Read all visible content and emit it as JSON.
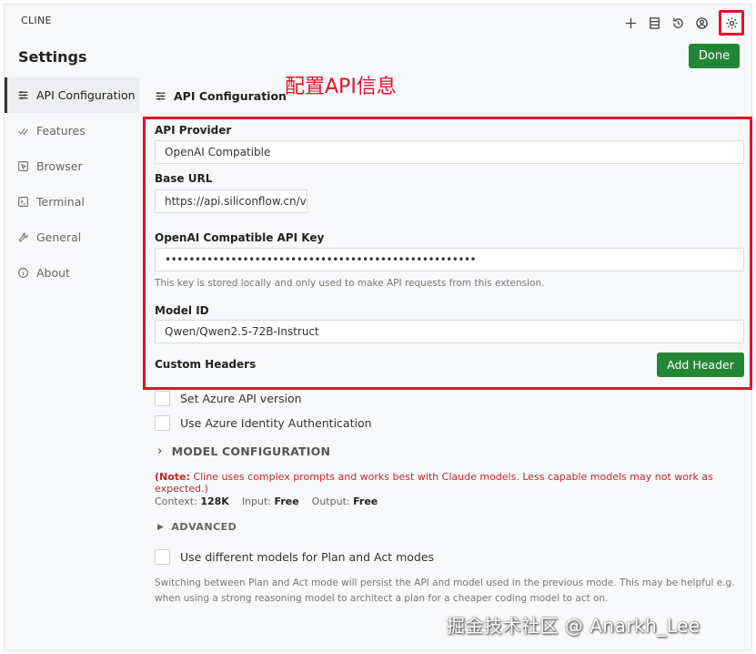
{
  "app": {
    "name": "CLINE"
  },
  "toolbar": {
    "icons": [
      "plus-icon",
      "history-list-icon",
      "history-icon",
      "account-icon",
      "gear-icon"
    ]
  },
  "page": {
    "title": "Settings",
    "done_label": "Done"
  },
  "sidebar": {
    "items": [
      {
        "label": "API Configuration",
        "icon": "sliders-icon",
        "active": true
      },
      {
        "label": "Features",
        "icon": "check-icon"
      },
      {
        "label": "Browser",
        "icon": "browser-icon"
      },
      {
        "label": "Terminal",
        "icon": "terminal-icon"
      },
      {
        "label": "General",
        "icon": "wrench-icon"
      },
      {
        "label": "About",
        "icon": "info-icon"
      }
    ]
  },
  "section": {
    "title": "API Configuration"
  },
  "annotation": {
    "text": "配置API信息",
    "color": "#e0142b"
  },
  "form": {
    "api_provider_label": "API Provider",
    "api_provider_value": "OpenAI Compatible",
    "base_url_label": "Base URL",
    "base_url_value": "https://api.siliconflow.cn/v",
    "api_key_label": "OpenAI Compatible API Key",
    "api_key_value": "••••••••••••••••••••••••••••••••••••••••••••••••••••",
    "api_key_hint": "This key is stored locally and only used to make API requests from this extension.",
    "model_id_label": "Model ID",
    "model_id_value": "Qwen/Qwen2.5-72B-Instruct",
    "custom_headers_label": "Custom Headers",
    "add_header_label": "Add Header"
  },
  "options": {
    "azure_version_label": "Set Azure API version",
    "azure_identity_label": "Use Azure Identity Authentication",
    "model_configuration_label": "MODEL CONFIGURATION",
    "note_prefix": "(Note:",
    "note_text": " Cline uses complex prompts and works best with Claude models. Less capable models may not work as expected.)",
    "context_label": "Context:",
    "context_value": "128K",
    "input_label": "Input:",
    "input_value": "Free",
    "output_label": "Output:",
    "output_value": "Free",
    "advanced_label": "ADVANCED",
    "plan_act_label": "Use different models for Plan and Act modes",
    "plan_act_hint": "Switching between Plan and Act mode will persist the API and model used in the previous mode. This may be helpful e.g. when using a strong reasoning model to architect a plan for a cheaper coding model to act on."
  },
  "watermark": {
    "text": "掘金技术社区 @ Anarkh_Lee"
  },
  "colors": {
    "accent_green": "#238636",
    "highlight_red": "#e0142b",
    "note_red": "#c0272d"
  }
}
